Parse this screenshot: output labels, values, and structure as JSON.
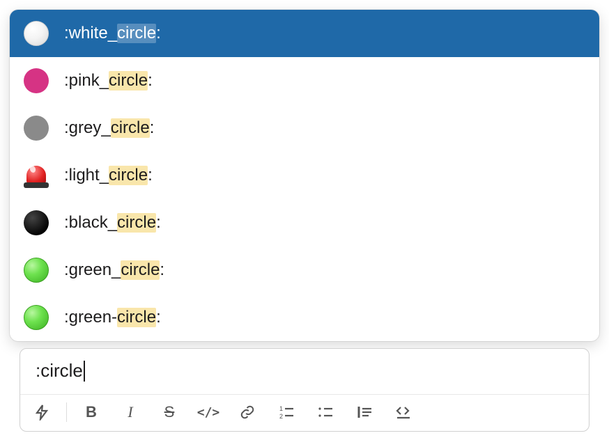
{
  "search_query": "circle",
  "input_value": ":circle",
  "emoji_results": [
    {
      "name": "white_circle",
      "prefix": ":white_",
      "match": "circle",
      "suffix": ":",
      "icon": "white-circle",
      "selected": true
    },
    {
      "name": "pink_circle",
      "prefix": ":pink_",
      "match": "circle",
      "suffix": ":",
      "icon": "pink-circle",
      "selected": false
    },
    {
      "name": "grey_circle",
      "prefix": ":grey_",
      "match": "circle",
      "suffix": ":",
      "icon": "grey-circle",
      "selected": false
    },
    {
      "name": "light_circle",
      "prefix": ":light_",
      "match": "circle",
      "suffix": ":",
      "icon": "rotating-light",
      "selected": false
    },
    {
      "name": "black_circle",
      "prefix": ":black_",
      "match": "circle",
      "suffix": ":",
      "icon": "black-circle",
      "selected": false
    },
    {
      "name": "green_circle",
      "prefix": ":green_",
      "match": "circle",
      "suffix": ":",
      "icon": "green-circle",
      "selected": false
    },
    {
      "name": "green-circle",
      "prefix": ":green-",
      "match": "circle",
      "suffix": ":",
      "icon": "green-circle",
      "selected": false
    }
  ],
  "toolbar": {
    "shortcuts_label": "Shortcuts",
    "bold_label": "B",
    "italic_label": "I",
    "strike_label": "S",
    "code_label": "</>",
    "link_label": "Link",
    "ordered_list_label": "Ordered list",
    "bullet_list_label": "Bullet list",
    "blockquote_label": "Blockquote",
    "codeblock_label": "Code block"
  }
}
